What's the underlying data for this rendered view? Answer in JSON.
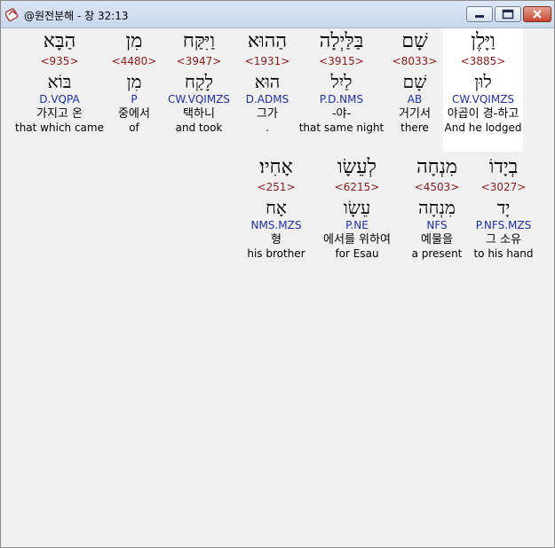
{
  "window": {
    "title": "@원전분해 - 창 32:13"
  },
  "colors": {
    "strong": "#8b1a1a",
    "parse": "#1f2fa8",
    "highlight": "#ffffff"
  },
  "rows": [
    {
      "words": [
        {
          "hebrew": "וַיָּלֶן",
          "strong": "<3885>",
          "lemma": "לוּן",
          "parse": "CW.VQIMZS",
          "korean": "야곱이 경-하고",
          "english": "And he lodged",
          "highlighted": true
        },
        {
          "hebrew": "שָׁם",
          "strong": "<8033>",
          "lemma": "שָׁם",
          "parse": "AB",
          "korean": "거기서",
          "english": "there",
          "highlighted": false
        },
        {
          "hebrew": "בַּלַּיְלָה",
          "strong": "<3915>",
          "lemma": "לַיִל",
          "parse": "P.D.NMS",
          "korean": "-야-",
          "english": "that same night",
          "highlighted": false
        },
        {
          "hebrew": "הַהוּא",
          "strong": "<1931>",
          "lemma": "הוּא",
          "parse": "D.ADMS",
          "korean": "그가",
          "english": ".",
          "highlighted": false
        },
        {
          "hebrew": "וַיִּקַּח",
          "strong": "<3947>",
          "lemma": "לָקַח",
          "parse": "CW.VQIMZS",
          "korean": "택하니",
          "english": "and took",
          "highlighted": false
        },
        {
          "hebrew": "מִן",
          "strong": "<4480>",
          "lemma": "מִן",
          "parse": "P",
          "korean": "중에서",
          "english": "of",
          "highlighted": false
        },
        {
          "hebrew": "הַבָּא",
          "strong": "<935>",
          "lemma": "בּוֹא",
          "parse": "D.VQPA",
          "korean": "가지고 온",
          "english": "that which came",
          "highlighted": false
        }
      ]
    },
    {
      "words": [
        {
          "hebrew": "בְיָדוֹ",
          "strong": "<3027>",
          "lemma": "יָד",
          "parse": "P.NFS.MZS",
          "korean": "그 소유",
          "english": "to his hand",
          "highlighted": false
        },
        {
          "hebrew": "מִנְחָה",
          "strong": "<4503>",
          "lemma": "מִנְחָה",
          "parse": "NFS",
          "korean": "예물을",
          "english": "a present",
          "highlighted": false
        },
        {
          "hebrew": "לְעֵשָׂו",
          "strong": "<6215>",
          "lemma": "עֵשָׂו",
          "parse": "P.NE",
          "korean": "에서를 위하여",
          "english": "for Esau",
          "highlighted": false
        },
        {
          "hebrew": "אָחִיו׃",
          "strong": "<251>",
          "lemma": "אָח",
          "parse": "NMS.MZS",
          "korean": "형",
          "english": "his brother",
          "highlighted": false
        }
      ]
    }
  ]
}
